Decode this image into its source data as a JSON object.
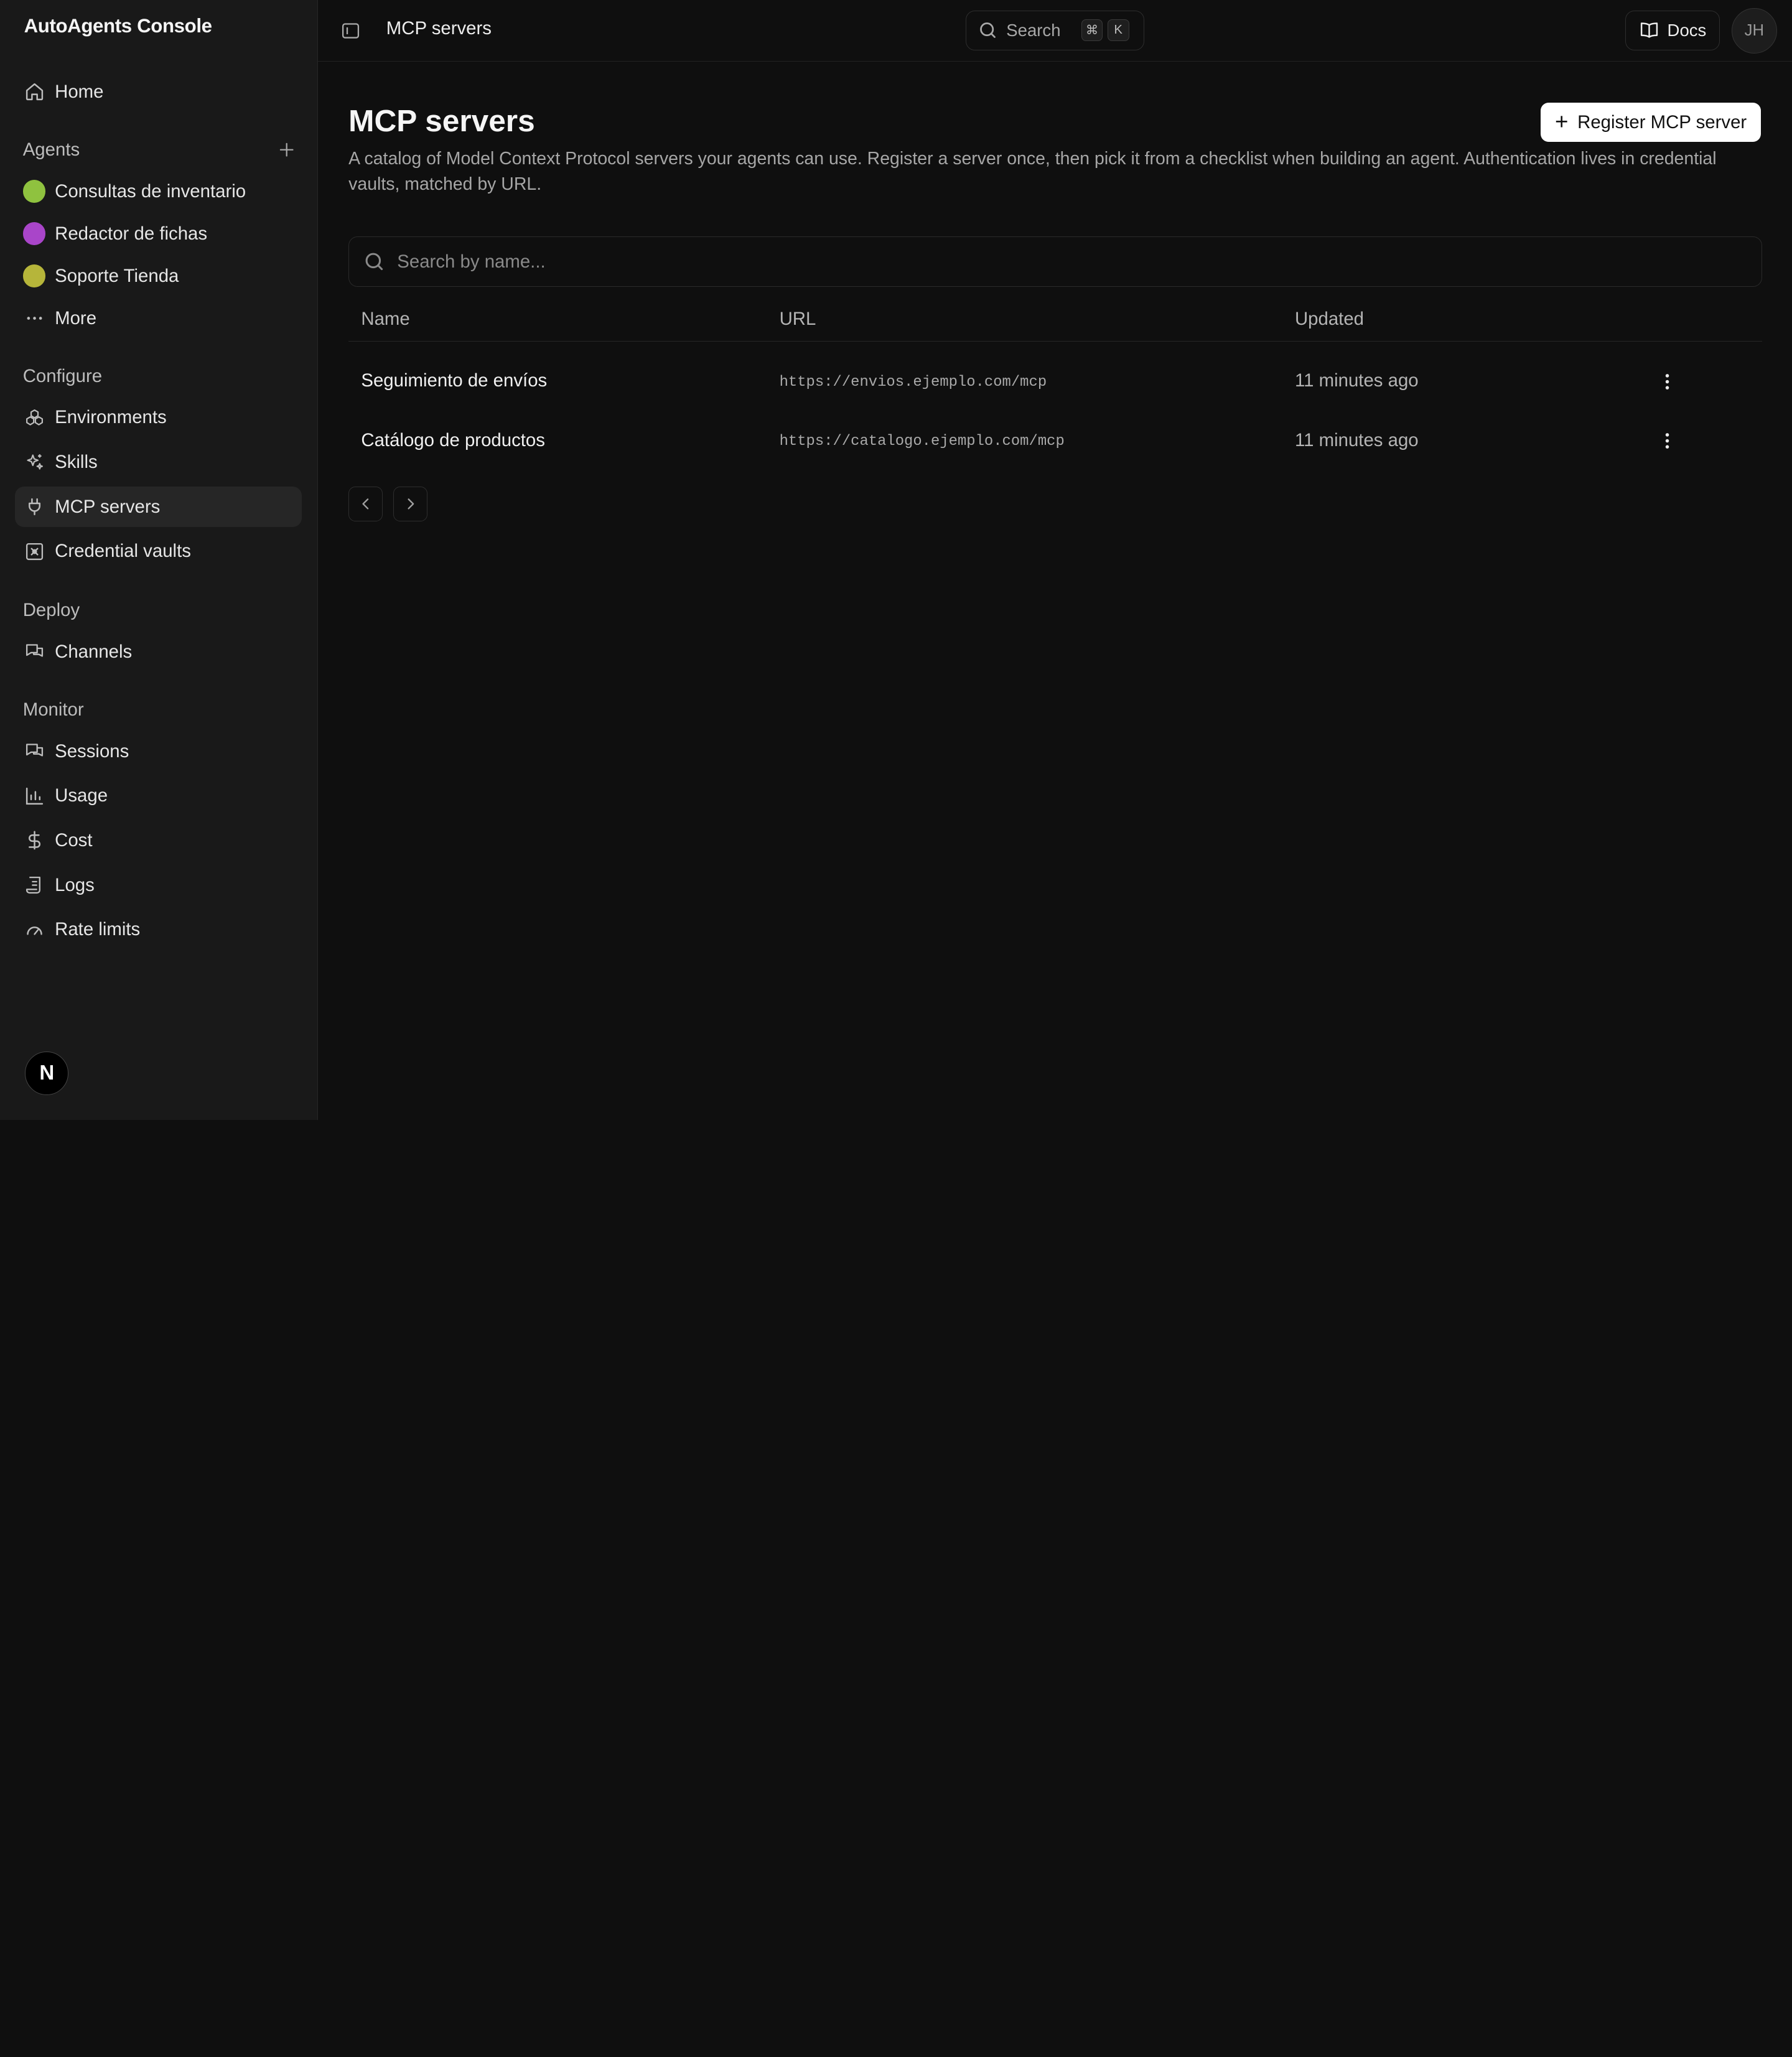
{
  "app": {
    "title": "AutoAgents Console"
  },
  "sidebar": {
    "home": "Home",
    "agents_label": "Agents",
    "agents": [
      {
        "label": "Consultas de inventario",
        "color": "#8fc23f"
      },
      {
        "label": "Redactor de fichas",
        "color": "#a945c9"
      },
      {
        "label": "Soporte Tienda",
        "color": "#b6b53a"
      }
    ],
    "more": "More",
    "configure_label": "Configure",
    "configure": [
      "Environments",
      "Skills",
      "MCP servers",
      "Credential vaults"
    ],
    "deploy_label": "Deploy",
    "deploy": [
      "Channels"
    ],
    "monitor_label": "Monitor",
    "monitor": [
      "Sessions",
      "Usage",
      "Cost",
      "Logs",
      "Rate limits"
    ],
    "badge": "N"
  },
  "header": {
    "breadcrumb": "MCP servers",
    "search_label": "Search",
    "kbd1": "⌘",
    "kbd2": "K",
    "docs": "Docs",
    "avatar": "JH"
  },
  "main": {
    "title": "MCP servers",
    "description": "A catalog of Model Context Protocol servers your agents can use. Register a server once, then pick it from a checklist when building an agent. Authentication lives in credential vaults, matched by URL.",
    "register_button": "Register MCP server",
    "search_placeholder": "Search by name...",
    "columns": [
      "Name",
      "URL",
      "Updated"
    ],
    "rows": [
      {
        "name": "Seguimiento de envíos",
        "url": "https://envios.ejemplo.com/mcp",
        "updated": "11 minutes ago"
      },
      {
        "name": "Catálogo de productos",
        "url": "https://catalogo.ejemplo.com/mcp",
        "updated": "11 minutes ago"
      }
    ]
  },
  "colors": {
    "accent_active": "#262626",
    "background": "#0f0f0f",
    "sidebar": "#191919"
  }
}
